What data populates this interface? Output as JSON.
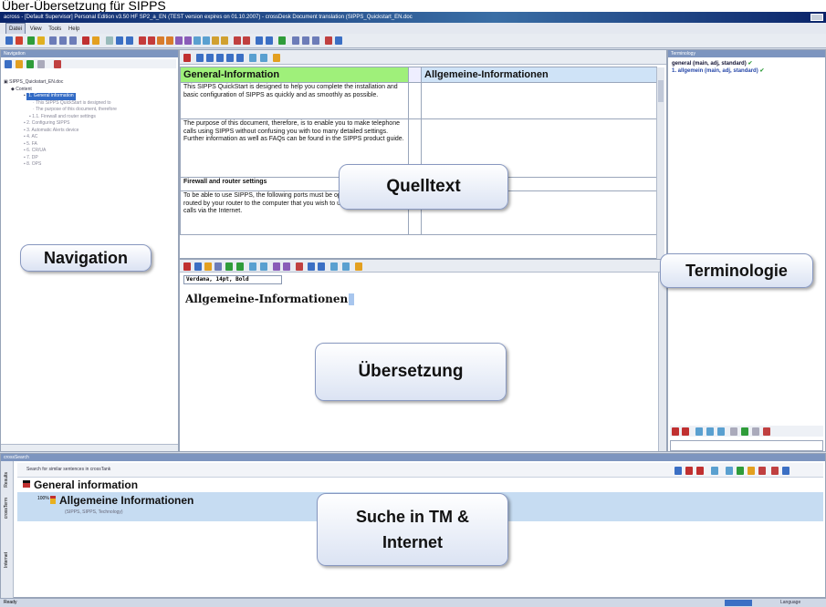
{
  "caption": "Über-Übersetzung für SIPPS",
  "window": {
    "title": "across - [Default Supervisor] Personal Edition v3.50 HF SP2_a_EN (TEST version expires on 01.10.2007) - crossDesk Document translation (SIPPS_Quickstart_EN.doc"
  },
  "menu": [
    "Datei",
    "View",
    "Tools",
    "Help"
  ],
  "navigation": {
    "header": "Navigation",
    "tree": [
      "SIPPS_Quickstart_EN.doc",
      "Content",
      "1. General information",
      "This SIPPS QuickStart is designed to",
      "The purpose of this document, therefore",
      "1.1. Firewall and router settings",
      "2. Configuring SIPPS",
      "3. Automatic Alerts device",
      "4. AC",
      "5. FA",
      "6. CR/UA",
      "7. DP",
      "8. OPS"
    ]
  },
  "source": {
    "col_en": "General-Information",
    "col_de": "Allgemeine-Informationen",
    "rows": [
      {
        "text": "This SIPPS QuickStart is designed to help you complete the installation and basic configuration of SIPPS as quickly and as smoothly as possible."
      },
      {
        "text": "The purpose of this document, therefore, is to enable you to make telephone calls using SIPPS without confusing you with too many detailed settings. Further information as well as FAQs can be found in the SIPPS product guide."
      },
      {
        "text": "Firewall and router settings"
      },
      {
        "text": "To be able to use SIPPS, the following ports must be open in your firewall or routed by your router to the computer that you wish to use to make telephone calls via the Internet."
      }
    ]
  },
  "editor": {
    "font_info": "Verdana, 14pt, Bold",
    "text": "Allgemeine-Informationen"
  },
  "terminology": {
    "header": "Terminology",
    "term1": "general (main, adj, standard)",
    "term2": "1. allgemein (main, adj, standard)"
  },
  "search": {
    "header": "crossSearch",
    "prompt": "Search for similar sentences in crossTank",
    "side_tabs": [
      "Results",
      "crossTerm",
      "Internet"
    ],
    "source": "General information",
    "target": "Allgemeine Informationen",
    "percent": "100%",
    "meta": "(SIPPS, SIPPS, Technology)"
  },
  "status": {
    "left": "Ready",
    "right": "Language"
  },
  "callouts": {
    "navigation": "Navigation",
    "source": "Quelltext",
    "terminology": "Terminologie",
    "translation": "Übersetzung",
    "search_line1": "Suche in TM &",
    "search_line2": "Internet"
  }
}
